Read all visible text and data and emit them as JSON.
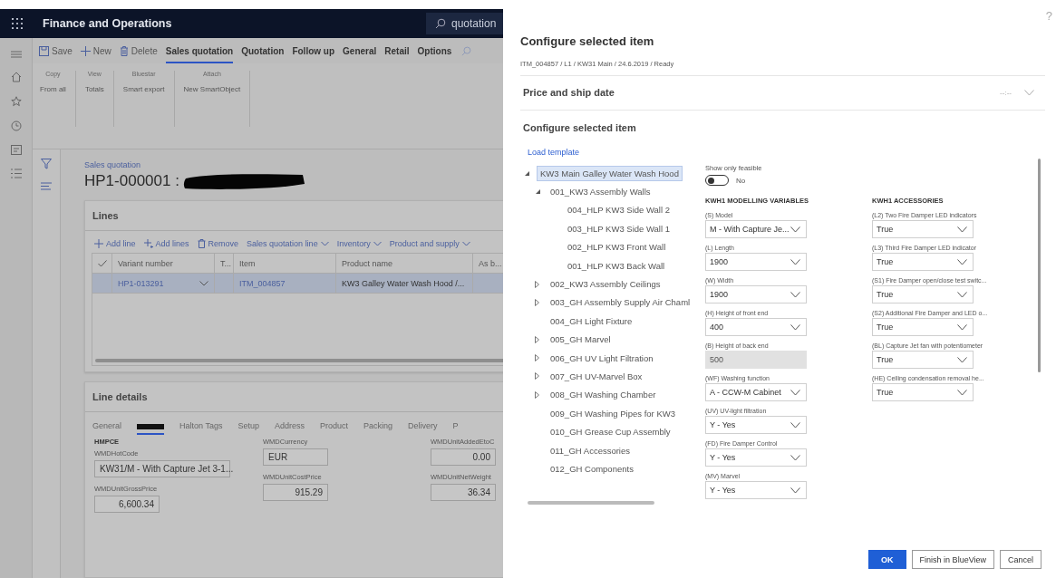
{
  "app": {
    "title": "Finance and Operations",
    "search": {
      "value": "quotation"
    }
  },
  "action_bar": {
    "buttons": [
      {
        "kind": "save",
        "label": "Save"
      },
      {
        "kind": "new",
        "label": "New"
      },
      {
        "kind": "delete",
        "label": "Delete"
      }
    ],
    "tabs": [
      {
        "label": "Sales quotation",
        "selected": true
      },
      {
        "label": "Quotation",
        "selected": false
      },
      {
        "label": "Follow up",
        "selected": false
      },
      {
        "label": "General",
        "selected": false
      },
      {
        "label": "Retail",
        "selected": false
      },
      {
        "label": "Options",
        "selected": false
      }
    ]
  },
  "ribbon": [
    {
      "heading": "Copy",
      "button": "From all"
    },
    {
      "heading": "View",
      "button": "Totals"
    },
    {
      "heading": "Bluestar",
      "button": "Smart export"
    },
    {
      "heading": "Attach",
      "button": "New SmartObject"
    }
  ],
  "page": {
    "breadcrumb": "Sales quotation",
    "title": "HP1-000001 :"
  },
  "lines": {
    "header": "Lines",
    "toolbar": [
      {
        "kind": "add",
        "label": "Add line"
      },
      {
        "kind": "addmany",
        "label": "Add lines"
      },
      {
        "kind": "remove",
        "label": "Remove"
      },
      {
        "kind": "menu",
        "label": "Sales quotation line"
      },
      {
        "kind": "menu",
        "label": "Inventory"
      },
      {
        "kind": "menu",
        "label": "Product and supply"
      }
    ],
    "columns": [
      "Variant number",
      "T...",
      "Item",
      "Product name",
      "As b..."
    ],
    "rows": [
      {
        "selected": true,
        "cells": [
          "HP1-013291",
          "",
          "ITM_004857",
          "KW3 Galley Water Wash Hood /...",
          ""
        ]
      }
    ]
  },
  "line_details": {
    "header": "Line details",
    "tabs": [
      {
        "kind": "text",
        "label": "General",
        "selected": false
      },
      {
        "kind": "redacted",
        "selected": true
      },
      {
        "kind": "text",
        "label": "Halton Tags",
        "selected": false
      },
      {
        "kind": "text",
        "label": "Setup",
        "selected": false
      },
      {
        "kind": "text",
        "label": "Address",
        "selected": false
      },
      {
        "kind": "text",
        "label": "Product",
        "selected": false
      },
      {
        "kind": "text",
        "label": "Packing",
        "selected": false
      },
      {
        "kind": "text",
        "label": "Delivery",
        "selected": false
      },
      {
        "kind": "text",
        "label": "P",
        "selected": false
      }
    ],
    "group": "HMPCE",
    "columns": [
      [
        {
          "label": "WMDHotCode",
          "value": "KW31/M - With Capture Jet 3-1...",
          "kind": "text"
        },
        {
          "label": "WMDUnitGrossPrice",
          "value": "6,600.34",
          "kind": "number"
        }
      ],
      [
        {
          "label": "WMDCurrency",
          "value": "EUR",
          "kind": "text"
        },
        {
          "label": "WMDUnitCostPrice",
          "value": "915.29",
          "kind": "number"
        }
      ],
      [
        {
          "label": "WMDUnitAddedEtoC",
          "value": "0.00",
          "kind": "number"
        },
        {
          "label": "WMDUnitNetWeight",
          "value": "36.34",
          "kind": "number"
        }
      ]
    ]
  },
  "dialog": {
    "help": "?",
    "title": "Configure selected item",
    "subtitle": "ITM_004857 / L1 / KW31 Main / 24.6.2019 / Ready",
    "price_section": {
      "label": "Price and ship date",
      "value": "--:--"
    },
    "config_section": "Configure selected item",
    "link": "Load template",
    "tree": [
      {
        "label": "KW3 Main Galley Water Wash Hood",
        "selected": true,
        "expanded": true,
        "children": [
          {
            "label": "001_KW3 Assembly Walls",
            "selected": false,
            "expanded": true,
            "children": [
              {
                "label": "004_HLP KW3 Side Wall 2",
                "selected": false
              },
              {
                "label": "003_HLP KW3 Side Wall 1",
                "selected": false
              },
              {
                "label": "002_HLP KW3 Front Wall",
                "selected": false
              },
              {
                "label": "001_HLP KW3 Back Wall",
                "selected": false
              }
            ]
          },
          {
            "label": "002_KW3 Assembly Ceilings",
            "selected": false,
            "expanded": false
          },
          {
            "label": "003_GH Assembly Supply Air Chaml",
            "selected": false,
            "expanded": false
          },
          {
            "label": "004_GH Light Fixture",
            "selected": false
          },
          {
            "label": "005_GH Marvel",
            "selected": false,
            "expanded": false
          },
          {
            "label": "006_GH UV Light Filtration",
            "selected": false,
            "expanded": false
          },
          {
            "label": "007_GH UV-Marvel Box",
            "selected": false,
            "expanded": false
          },
          {
            "label": "008_GH Washing Chamber",
            "selected": false,
            "expanded": false
          },
          {
            "label": "009_GH Washing Pipes for KW3",
            "selected": false
          },
          {
            "label": "010_GH Grease Cup Assembly",
            "selected": false
          },
          {
            "label": "011_GH Accessories",
            "selected": false
          },
          {
            "label": "012_GH Components",
            "selected": false
          }
        ]
      }
    ],
    "feasible": {
      "label": "Show only feasible",
      "on": false,
      "state": "No"
    },
    "groups": [
      {
        "heading": "KWH1 MODELLING VARIABLES",
        "fields": [
          {
            "label": "(S) Model",
            "value": "M - With Capture Je...",
            "disabled": false
          },
          {
            "label": "(L) Length",
            "value": "1900",
            "disabled": false
          },
          {
            "label": "(W) Width",
            "value": "1900",
            "disabled": false
          },
          {
            "label": "(H) Height of front end",
            "value": "400",
            "disabled": false
          },
          {
            "label": "(B) Height of back end",
            "value": "500",
            "disabled": true
          },
          {
            "label": "(WF) Washing function",
            "value": "A - CCW-M Cabinet",
            "disabled": false
          },
          {
            "label": "(UV) UV-light filtration",
            "value": "Y - Yes",
            "disabled": false
          },
          {
            "label": "(FD) Fire Damper Control",
            "value": "Y - Yes",
            "disabled": false
          },
          {
            "label": "(MV) Marvel",
            "value": "Y - Yes",
            "disabled": false
          }
        ]
      },
      {
        "heading": "KWH1 ACCESSORIES",
        "fields": [
          {
            "label": "(L2) Two Fire Damper LED indicators",
            "value": "True",
            "disabled": false
          },
          {
            "label": "(L3) Third Fire Damper LED indicator",
            "value": "True",
            "disabled": false
          },
          {
            "label": "(S1) Fire Damper open/close test switc...",
            "value": "True",
            "disabled": false
          },
          {
            "label": "(S2) Additional Fire Damper and LED o...",
            "value": "True",
            "disabled": false
          },
          {
            "label": "(BL) Capture Jet fan with potentiometer",
            "value": "True",
            "disabled": false
          },
          {
            "label": "(HE) Ceiling condensation removal he...",
            "value": "True",
            "disabled": false
          }
        ]
      }
    ],
    "buttons": [
      {
        "label": "OK",
        "primary": true
      },
      {
        "label": "Finish in BlueView",
        "primary": false
      },
      {
        "label": "Cancel",
        "primary": false
      }
    ]
  }
}
